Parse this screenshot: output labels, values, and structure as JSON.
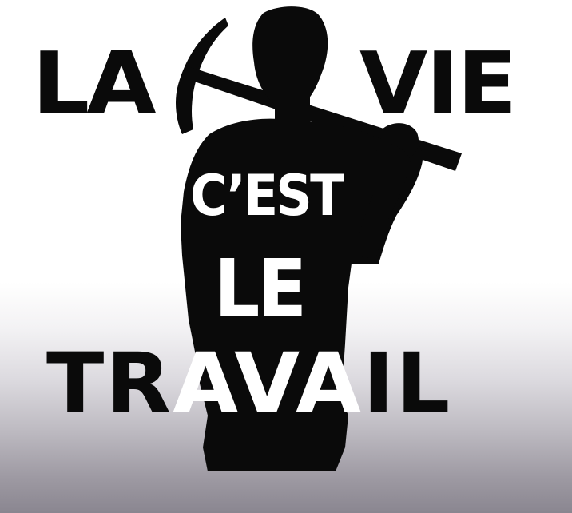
{
  "poster": {
    "line1_left": "LA",
    "line1_right": "VIE",
    "line2": "C’EST",
    "line3": "LE",
    "line4_part1": "TR",
    "line4_part2": "AVA",
    "line4_part3": "IL"
  },
  "colors": {
    "silhouette": "#0a0a0a",
    "text_dark": "#0a0a0a",
    "text_light": "#ffffff",
    "background_top": "#ffffff",
    "background_bottom": "#8a8690"
  },
  "icons": {
    "figure": "miner-with-pickaxe-silhouette"
  }
}
